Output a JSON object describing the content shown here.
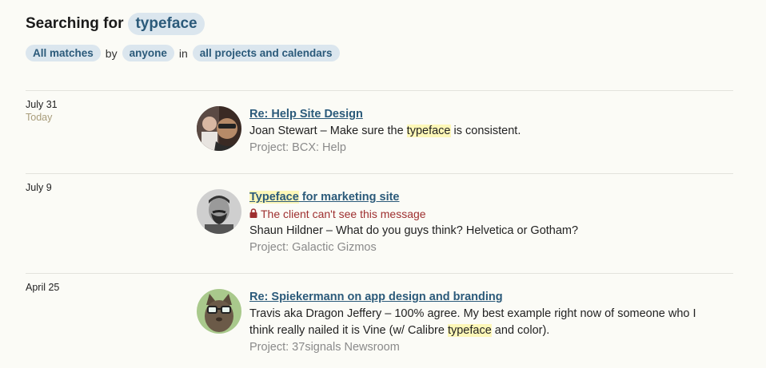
{
  "search": {
    "prefix": "Searching for",
    "query": "typeface",
    "filter_match": "All matches",
    "word_by": "by",
    "filter_person": "anyone",
    "word_in": "in",
    "filter_scope": "all projects and calendars"
  },
  "results": [
    {
      "date": "July 31",
      "date_sub": "Today",
      "title": "Re: Help Site Design",
      "author": "Joan Stewart",
      "excerpt_before": " – Make sure the ",
      "excerpt_highlight": "typeface",
      "excerpt_after": " is consistent.",
      "project": "Project: BCX: Help"
    },
    {
      "date": "July 9",
      "title_highlight": "Typeface",
      "title_rest": " for marketing site",
      "private_note": "The client can't see this message",
      "author": "Shaun Hildner",
      "excerpt": " – What do you guys think?  Helvetica or Gotham?",
      "project": "Project: Galactic Gizmos"
    },
    {
      "date": "April 25",
      "title": "Re: Spiekermann on app design and branding",
      "author": "Travis aka Dragon Jeffery",
      "excerpt_line1": " – 100% agree. My best example right now of someone who I",
      "excerpt_line2_before": "think really nailed it is Vine (w/ Calibre ",
      "excerpt_highlight": "typeface",
      "excerpt_line2_after": " and color).",
      "project": "Project: 37signals Newsroom"
    }
  ],
  "colors": {
    "chip_bg": "#dbe6ee",
    "chip_text": "#2b5a7a",
    "highlight": "#fdf7b8",
    "private_text": "#9e2f2f"
  }
}
